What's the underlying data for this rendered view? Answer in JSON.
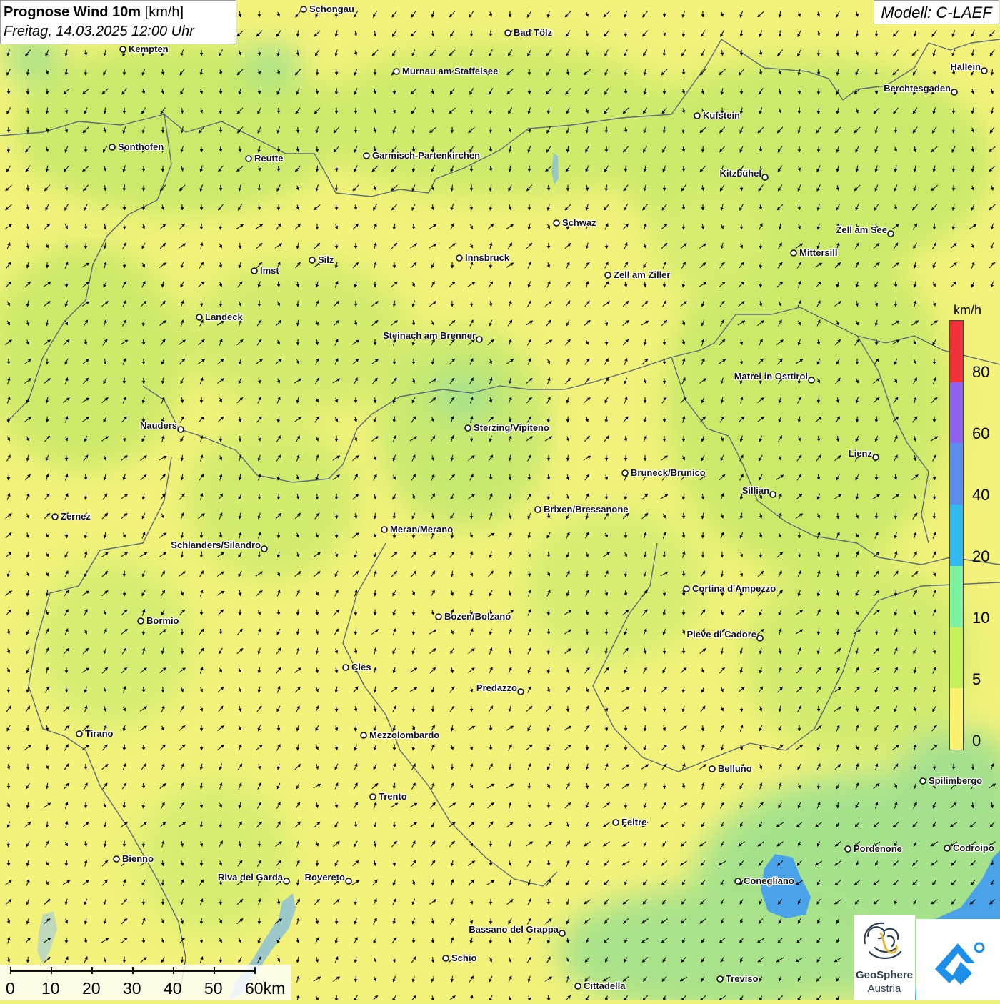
{
  "header": {
    "title_bold": "Prognose Wind 10m",
    "title_unit": "[km/h]",
    "datetime": "Freitag, 14.03.2025 12:00 Uhr",
    "model": "Modell: C-LAEF"
  },
  "legend": {
    "unit": "km/h",
    "ticks": [
      "80",
      "60",
      "40",
      "20",
      "10",
      "5",
      "0"
    ],
    "colors": [
      "#f0333a",
      "#8e62ee",
      "#5b8def",
      "#35b8f0",
      "#7ef0a0",
      "#c5f05a",
      "#fbf370"
    ]
  },
  "scale_bar": {
    "labels": [
      "0",
      "10",
      "20",
      "30",
      "40",
      "50",
      "60km"
    ]
  },
  "logos": {
    "geosphere_line1": "GeoSphere",
    "geosphere_line2": "Austria",
    "geosphere_icon": "geosphere-logo-icon",
    "app_icon": "warning-app-logo-icon"
  },
  "map_colors": {
    "calm": "#f4f27a",
    "light": "#c9ea6a",
    "moderate": "#a7e38a",
    "water": "#4aa3e8",
    "border": "#5c6b7a",
    "city_fill": "#ffffff",
    "arrow": "#000000"
  },
  "places": [
    {
      "name": "Schongau"
    },
    {
      "name": "Bad Tölz"
    },
    {
      "name": "Kempten"
    },
    {
      "name": "Murnau am Staffelsee"
    },
    {
      "name": "Hallein"
    },
    {
      "name": "Berchtesgaden"
    },
    {
      "name": "Kufstein"
    },
    {
      "name": "Sonthofen"
    },
    {
      "name": "Reutte"
    },
    {
      "name": "Garmisch-Partenkirchen"
    },
    {
      "name": "Kitzbühel"
    },
    {
      "name": "Schwaz"
    },
    {
      "name": "Zell am See"
    },
    {
      "name": "Mittersill"
    },
    {
      "name": "Imst"
    },
    {
      "name": "Silz"
    },
    {
      "name": "Innsbruck"
    },
    {
      "name": "Zell am Ziller"
    },
    {
      "name": "Landeck"
    },
    {
      "name": "Steinach am Brenner"
    },
    {
      "name": "Matrei in Osttirol"
    },
    {
      "name": "Nauders"
    },
    {
      "name": "Sterzing/Vipiteno"
    },
    {
      "name": "Lienz"
    },
    {
      "name": "Bruneck/Brunico"
    },
    {
      "name": "Sillian"
    },
    {
      "name": "Zernez"
    },
    {
      "name": "Brixen/Bressanone"
    },
    {
      "name": "Meran/Merano"
    },
    {
      "name": "Schlanders/Silandro"
    },
    {
      "name": "Cortina d'Ampezzo"
    },
    {
      "name": "Bormio"
    },
    {
      "name": "Bozen/Bolzano"
    },
    {
      "name": "Pieve di Cadore"
    },
    {
      "name": "Cles"
    },
    {
      "name": "Predazzo"
    },
    {
      "name": "Tirano"
    },
    {
      "name": "Mezzolombardo"
    },
    {
      "name": "Belluno"
    },
    {
      "name": "Spilimbergo"
    },
    {
      "name": "Trento"
    },
    {
      "name": "Feltre"
    },
    {
      "name": "Pordenone"
    },
    {
      "name": "Codroipo"
    },
    {
      "name": "Bienno"
    },
    {
      "name": "Riva del Garda"
    },
    {
      "name": "Rovereto"
    },
    {
      "name": "Conegliano"
    },
    {
      "name": "Bassano del Grappa"
    },
    {
      "name": "Schio"
    },
    {
      "name": "Treviso"
    },
    {
      "name": "Cittadella"
    }
  ]
}
